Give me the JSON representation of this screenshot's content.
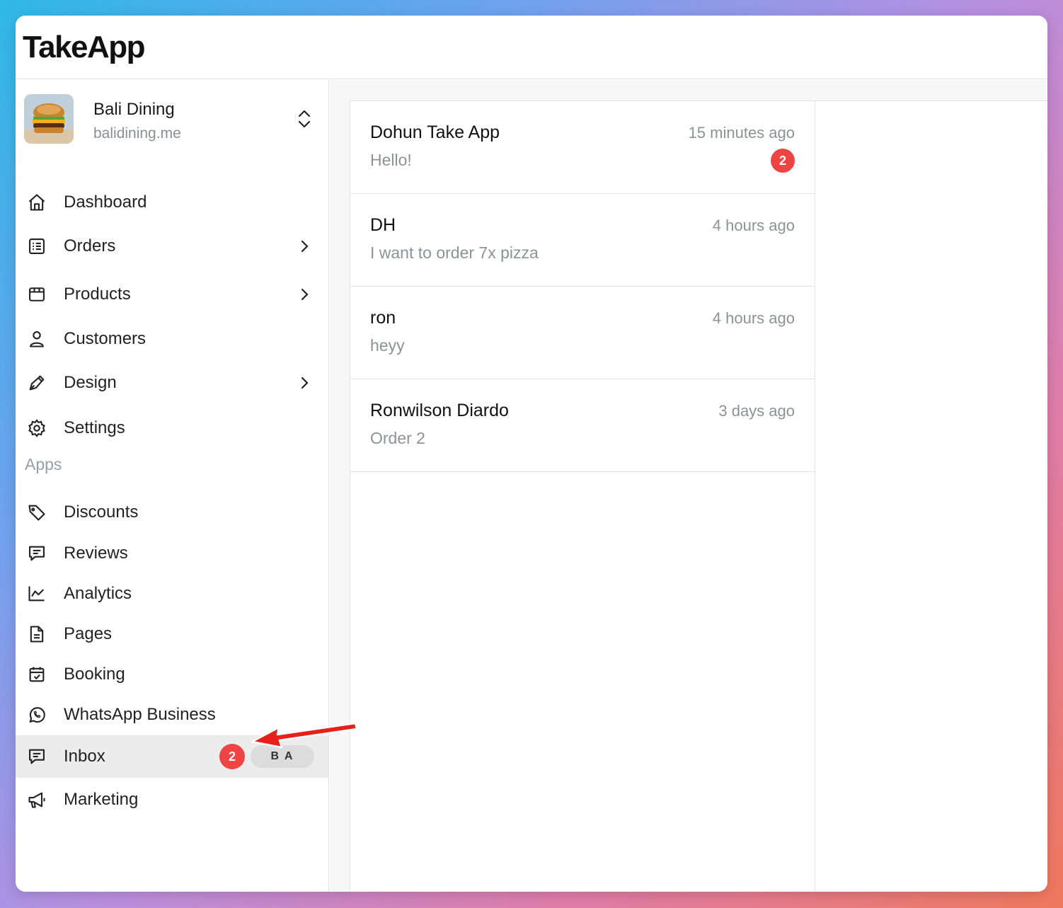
{
  "app": {
    "logo": "TakeApp"
  },
  "store": {
    "name": "Bali Dining",
    "domain": "balidining.me",
    "avatar_icon": "burger-image"
  },
  "nav": [
    {
      "key": "dashboard",
      "label": "Dashboard",
      "icon": "home-icon",
      "chevron": false
    },
    {
      "key": "orders",
      "label": "Orders",
      "icon": "list-icon",
      "chevron": true
    },
    {
      "key": "products",
      "label": "Products",
      "icon": "box-icon",
      "chevron": true
    },
    {
      "key": "customers",
      "label": "Customers",
      "icon": "user-icon",
      "chevron": false
    },
    {
      "key": "design",
      "label": "Design",
      "icon": "pen-icon",
      "chevron": true
    },
    {
      "key": "settings",
      "label": "Settings",
      "icon": "gear-icon",
      "chevron": false
    }
  ],
  "apps_heading": "Apps",
  "apps": [
    {
      "key": "discounts",
      "label": "Discounts",
      "icon": "tag-icon"
    },
    {
      "key": "reviews",
      "label": "Reviews",
      "icon": "comment-icon"
    },
    {
      "key": "analytics",
      "label": "Analytics",
      "icon": "chart-icon"
    },
    {
      "key": "pages",
      "label": "Pages",
      "icon": "document-icon"
    },
    {
      "key": "booking",
      "label": "Booking",
      "icon": "calendar-icon"
    },
    {
      "key": "whatsapp",
      "label": "WhatsApp Business",
      "icon": "whatsapp-icon"
    },
    {
      "key": "inbox",
      "label": "Inbox",
      "icon": "chat-icon",
      "badge": "2",
      "pill": "B A",
      "active": true
    },
    {
      "key": "marketing",
      "label": "Marketing",
      "icon": "megaphone-icon"
    }
  ],
  "conversations": [
    {
      "name": "Dohun Take App",
      "preview": "Hello!",
      "time": "15 minutes ago",
      "unread": "2"
    },
    {
      "name": "DH",
      "preview": "I want to order 7x pizza",
      "time": "4 hours ago"
    },
    {
      "name": "ron",
      "preview": "heyy",
      "time": "4 hours ago"
    },
    {
      "name": "Ronwilson Diardo",
      "preview": "Order 2",
      "time": "3 days ago"
    }
  ],
  "colors": {
    "badge": "#ef4444",
    "active_bg": "#ececec",
    "annotation_arrow": "#e8201a"
  }
}
